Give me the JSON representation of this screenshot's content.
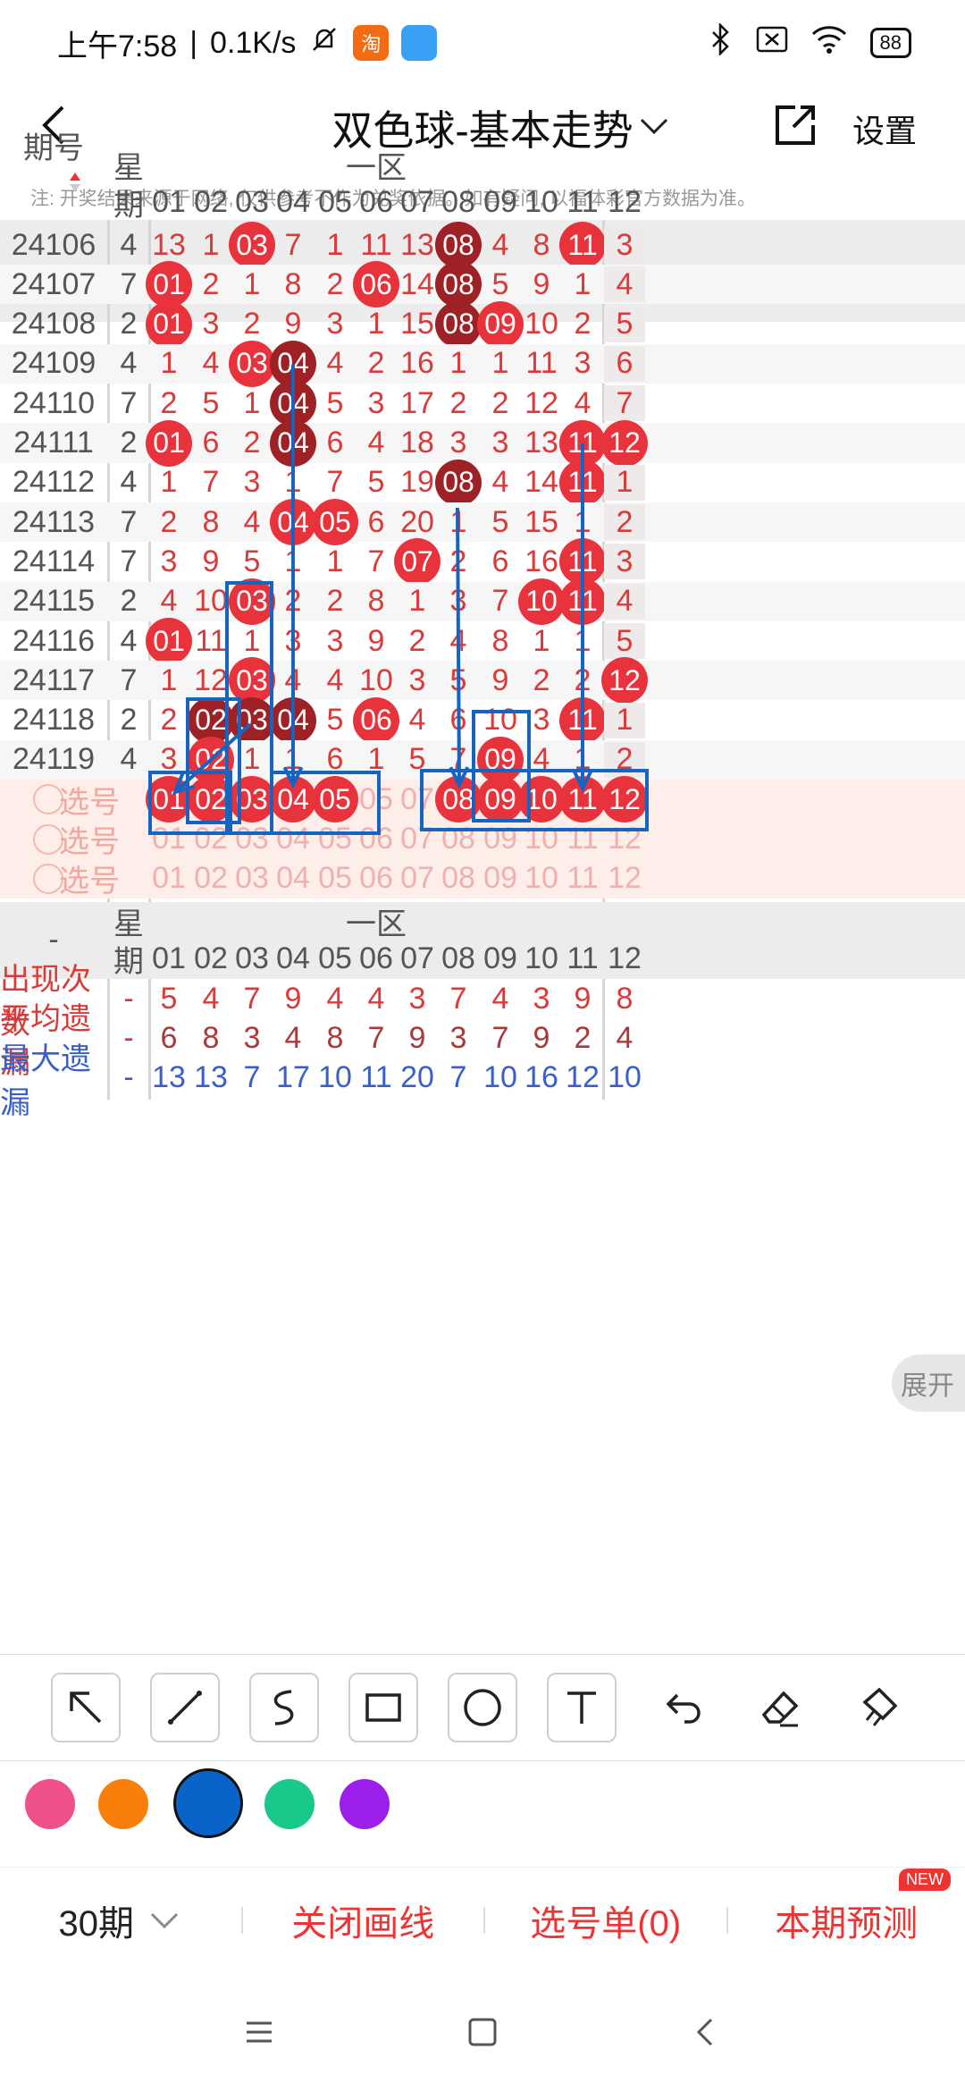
{
  "status": {
    "time": "上午7:58",
    "net": "0.1K/s",
    "battery": "88",
    "app1": "淘",
    "app2": "●"
  },
  "titlebar": {
    "title": "双色球-基本走势",
    "settings": "设置"
  },
  "note": "注: 开奖结果来源于网络, 仅供参考不作为兑奖依据。如有疑问, 以福体彩官方数据为准。",
  "table": {
    "period_header": "期号",
    "week_header_1": "星",
    "week_header_2": "期",
    "zone_header": "一区",
    "columns": [
      "01",
      "02",
      "03",
      "04",
      "05",
      "06",
      "07",
      "08",
      "09",
      "10",
      "11",
      "12"
    ],
    "rows": [
      {
        "period": "24106",
        "week": "4",
        "cells": [
          "13",
          "1",
          "03",
          "7",
          "1",
          "11",
          "13",
          "08",
          "4",
          "8",
          "11",
          "3"
        ]
      },
      {
        "period": "24107",
        "week": "7",
        "cells": [
          "01",
          "2",
          "1",
          "8",
          "2",
          "06",
          "14",
          "08",
          "5",
          "9",
          "1",
          "4"
        ]
      },
      {
        "period": "24108",
        "week": "2",
        "cells": [
          "01",
          "3",
          "2",
          "9",
          "3",
          "1",
          "15",
          "08",
          "09",
          "10",
          "2",
          "5"
        ]
      },
      {
        "period": "24109",
        "week": "4",
        "cells": [
          "1",
          "4",
          "03",
          "04",
          "4",
          "2",
          "16",
          "1",
          "1",
          "11",
          "3",
          "6"
        ]
      },
      {
        "period": "24110",
        "week": "7",
        "cells": [
          "2",
          "5",
          "1",
          "04",
          "5",
          "3",
          "17",
          "2",
          "2",
          "12",
          "4",
          "7"
        ]
      },
      {
        "period": "24111",
        "week": "2",
        "cells": [
          "01",
          "6",
          "2",
          "04",
          "6",
          "4",
          "18",
          "3",
          "3",
          "13",
          "11",
          "12"
        ]
      },
      {
        "period": "24112",
        "week": "4",
        "cells": [
          "1",
          "7",
          "3",
          "1",
          "7",
          "5",
          "19",
          "08",
          "4",
          "14",
          "11",
          "1"
        ]
      },
      {
        "period": "24113",
        "week": "7",
        "cells": [
          "2",
          "8",
          "4",
          "04",
          "05",
          "6",
          "20",
          "1",
          "5",
          "15",
          "1",
          "2"
        ]
      },
      {
        "period": "24114",
        "week": "7",
        "cells": [
          "3",
          "9",
          "5",
          "1",
          "1",
          "7",
          "07",
          "2",
          "6",
          "16",
          "11",
          "3"
        ]
      },
      {
        "period": "24115",
        "week": "2",
        "cells": [
          "4",
          "10",
          "03",
          "2",
          "2",
          "8",
          "1",
          "3",
          "7",
          "10",
          "11",
          "4"
        ]
      },
      {
        "period": "24116",
        "week": "4",
        "cells": [
          "01",
          "11",
          "1",
          "3",
          "3",
          "9",
          "2",
          "4",
          "8",
          "1",
          "1",
          "5"
        ]
      },
      {
        "period": "24117",
        "week": "7",
        "cells": [
          "1",
          "12",
          "03",
          "4",
          "4",
          "10",
          "3",
          "5",
          "9",
          "2",
          "2",
          "12"
        ]
      },
      {
        "period": "24118",
        "week": "2",
        "cells": [
          "2",
          "02",
          "03",
          "04",
          "5",
          "06",
          "4",
          "6",
          "10",
          "3",
          "11",
          "1"
        ]
      },
      {
        "period": "24119",
        "week": "4",
        "cells": [
          "3",
          "02",
          "1",
          "1",
          "6",
          "1",
          "5",
          "7",
          "09",
          "4",
          "1",
          "2"
        ]
      }
    ],
    "select_label": "选号",
    "select_rows": [
      [
        "01",
        "02",
        "03",
        "04",
        "05",
        "05",
        "07",
        "08",
        "09",
        "10",
        "11",
        "12"
      ],
      [
        "01",
        "02",
        "03",
        "04",
        "05",
        "06",
        "07",
        "08",
        "09",
        "10",
        "11",
        "12"
      ],
      [
        "01",
        "02",
        "03",
        "04",
        "05",
        "06",
        "07",
        "08",
        "09",
        "10",
        "11",
        "12"
      ]
    ]
  },
  "stats": {
    "dash": "-",
    "expand": "展开",
    "rows": [
      {
        "label": "出现次数",
        "color": "#d93b3b",
        "values": [
          "5",
          "4",
          "7",
          "9",
          "4",
          "4",
          "3",
          "7",
          "4",
          "3",
          "9",
          "8"
        ]
      },
      {
        "label": "平均遗漏",
        "color": "#a83a3a",
        "values": [
          "6",
          "8",
          "3",
          "4",
          "8",
          "7",
          "9",
          "3",
          "7",
          "9",
          "2",
          "4"
        ]
      },
      {
        "label": "最大遗漏",
        "color": "#3a5fc8",
        "values": [
          "13",
          "13",
          "7",
          "17",
          "10",
          "11",
          "20",
          "7",
          "10",
          "16",
          "12",
          "10"
        ]
      }
    ]
  },
  "colors": {
    "accent": "#e8333c",
    "draw": "#1565c0",
    "swatches": [
      "#f0508a",
      "#f77f0a",
      "#0a63c9",
      "#19c98a",
      "#9b1fe8"
    ]
  },
  "bottom": {
    "periods": "30期",
    "close_line": "关闭画线",
    "pick_list": "选号单(0)",
    "predict": "本期预测",
    "new_badge": "NEW"
  }
}
